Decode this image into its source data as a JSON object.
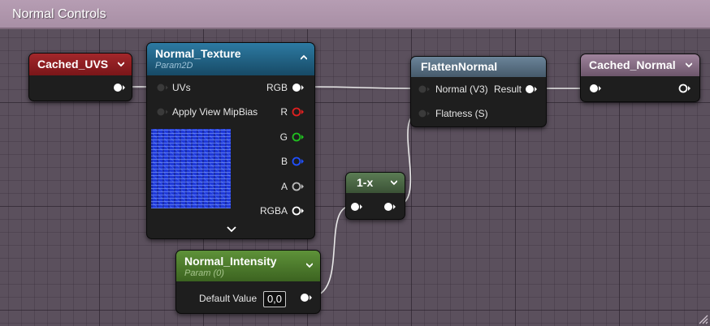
{
  "comment": {
    "title": "Normal Controls"
  },
  "nodes": {
    "cached_uvs": {
      "title": "Cached_UVS",
      "header_color": "#8c1a1d"
    },
    "normal_texture": {
      "title": "Normal_Texture",
      "subtitle": "Param2D",
      "header_color": "#1f5f80",
      "inputs": [
        "UVs",
        "Apply View MipBias"
      ],
      "outputs": [
        "RGB",
        "R",
        "G",
        "B",
        "A",
        "RGBA"
      ],
      "output_pin_colors": [
        "#ffffff",
        "#e02020",
        "#20c020",
        "#2050ff",
        "#bbbbbb",
        "#ffffff"
      ]
    },
    "flatten_normal": {
      "title": "FlattenNormal",
      "header_color": "#566d80",
      "inputs": [
        "Normal (V3)",
        "Flatness (S)"
      ],
      "output": "Result"
    },
    "cached_normal": {
      "title": "Cached_Normal",
      "header_color": "#8a7088"
    },
    "one_minus": {
      "title": "1-x",
      "header_color": "#4d6a47"
    },
    "normal_intensity": {
      "title": "Normal_Intensity",
      "subtitle": "Param (0)",
      "header_color": "#4b7a2c",
      "default_label": "Default Value",
      "default_value": "0,0"
    }
  },
  "icons": [
    "chevron-down-icon",
    "chevron-up-icon",
    "exec-pin-icon",
    "resize-grip-icon"
  ]
}
